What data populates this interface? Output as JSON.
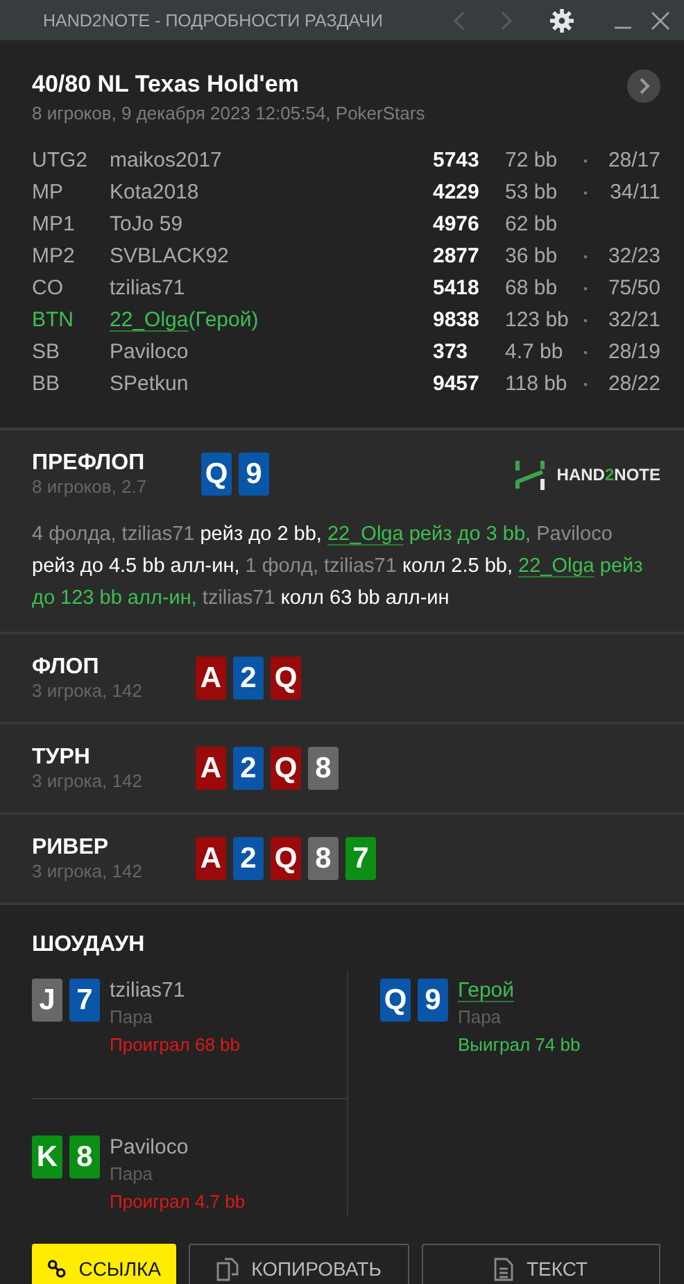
{
  "window": {
    "title": "HAND2NOTE - ПОДРОБНОСТИ РАЗДАЧИ"
  },
  "header": {
    "title": "40/80 NL Texas Hold'em",
    "subtitle": "8 игроков, 9 декабря 2023 12:05:54, PokerStars"
  },
  "players": [
    {
      "position": "UTG2",
      "name": "maikos2017",
      "stack": "5743",
      "bb": "72 bb",
      "stats": "28/17",
      "hero": false
    },
    {
      "position": "MP",
      "name": "Kota2018",
      "stack": "4229",
      "bb": "53 bb",
      "stats": "34/11",
      "hero": false
    },
    {
      "position": "MP1",
      "name": "ToJo 59",
      "stack": "4976",
      "bb": "62 bb",
      "hero": false
    },
    {
      "position": "MP2",
      "name": "SVBLACK92",
      "stack": "2877",
      "bb": "36 bb",
      "stats": "32/23",
      "hero": false
    },
    {
      "position": "CO",
      "name": "tzilias71",
      "stack": "5418",
      "bb": "68 bb",
      "stats": "75/50",
      "hero": false
    },
    {
      "position": "BTN",
      "name": "22_Olga",
      "suffix": "(Герой)",
      "stack": "9838",
      "bb": "123 bb",
      "stats": "32/21",
      "hero": true
    },
    {
      "position": "SB",
      "name": "Paviloco",
      "stack": "373",
      "bb": "4.7 bb",
      "stats": "28/19",
      "hero": false
    },
    {
      "position": "BB",
      "name": "SPetkun",
      "stack": "9457",
      "bb": "118 bb",
      "stats": "28/22",
      "hero": false
    }
  ],
  "logo": [
    "HAND",
    "2",
    "NOTE"
  ],
  "streets": [
    {
      "name": "ПРЕФЛОП",
      "info": "8 игроков, 2.7",
      "cards": [
        {
          "rank": "Q",
          "color": "#0a56a8"
        },
        {
          "rank": "9",
          "color": "#0a56a8"
        }
      ],
      "actions": [
        {
          "kind": "muted",
          "text": "4 фолда, tzilias71 "
        },
        {
          "kind": "bright",
          "text": "рейз до 2 bb, "
        },
        {
          "kind": "hero_link",
          "text": "22_Olga"
        },
        {
          "kind": "hero",
          "text": " рейз до 3 bb, "
        },
        {
          "kind": "muted",
          "text": "Paviloco "
        },
        {
          "kind": "bright",
          "text": "рейз до 4.5 bb алл-ин, "
        },
        {
          "kind": "muted",
          "text": "1 фолд, tzilias71 "
        },
        {
          "kind": "bright",
          "text": "колл 2.5 bb, "
        },
        {
          "kind": "hero_link",
          "text": "22_Olga"
        },
        {
          "kind": "hero",
          "text": " рейз до 123 bb алл-ин, "
        },
        {
          "kind": "muted",
          "text": "tzilias71 "
        },
        {
          "kind": "bright",
          "text": "колл 63 bb алл-ин"
        }
      ]
    },
    {
      "name": "ФЛОП",
      "info": "3 игрока, 142",
      "cards": [
        {
          "rank": "A",
          "color": "#9a0a0a"
        },
        {
          "rank": "2",
          "color": "#0a56a8"
        },
        {
          "rank": "Q",
          "color": "#9a0a0a"
        }
      ]
    },
    {
      "name": "ТУРН",
      "info": "3 игрока, 142",
      "cards": [
        {
          "rank": "A",
          "color": "#9a0a0a"
        },
        {
          "rank": "2",
          "color": "#0a56a8"
        },
        {
          "rank": "Q",
          "color": "#9a0a0a"
        },
        {
          "rank": "8",
          "color": "#686868"
        }
      ]
    },
    {
      "name": "РИВЕР",
      "info": "3 игрока, 142",
      "cards": [
        {
          "rank": "A",
          "color": "#9a0a0a"
        },
        {
          "rank": "2",
          "color": "#0a56a8"
        },
        {
          "rank": "Q",
          "color": "#9a0a0a"
        },
        {
          "rank": "8",
          "color": "#686868"
        },
        {
          "rank": "7",
          "color": "#0b8f14"
        }
      ]
    }
  ],
  "showdown": {
    "title": "ШОУДАУН",
    "left": [
      {
        "name": "tzilias71",
        "hand": "Пара",
        "result": "Проиграл 68 bb",
        "won": false,
        "hero": false,
        "cards": [
          {
            "rank": "J",
            "color": "#686868"
          },
          {
            "rank": "7",
            "color": "#0a56a8"
          }
        ]
      },
      {
        "name": "Paviloco",
        "hand": "Пара",
        "result": "Проиграл 4.7 bb",
        "won": false,
        "hero": false,
        "cards": [
          {
            "rank": "K",
            "color": "#0b8f14"
          },
          {
            "rank": "8",
            "color": "#0b8f14"
          }
        ]
      }
    ],
    "right": [
      {
        "name": "Герой",
        "hand": "Пара",
        "result": "Выиграл 74 bb",
        "won": true,
        "hero": true,
        "cards": [
          {
            "rank": "Q",
            "color": "#0a56a8"
          },
          {
            "rank": "9",
            "color": "#0a56a8"
          }
        ]
      }
    ]
  },
  "buttons": [
    {
      "label": "ССЫЛКА",
      "kind": "link",
      "primary": true
    },
    {
      "label": "КОПИРОВАТЬ",
      "kind": "copy",
      "primary": false
    },
    {
      "label": "ТЕКСТ",
      "kind": "text",
      "primary": false
    }
  ]
}
